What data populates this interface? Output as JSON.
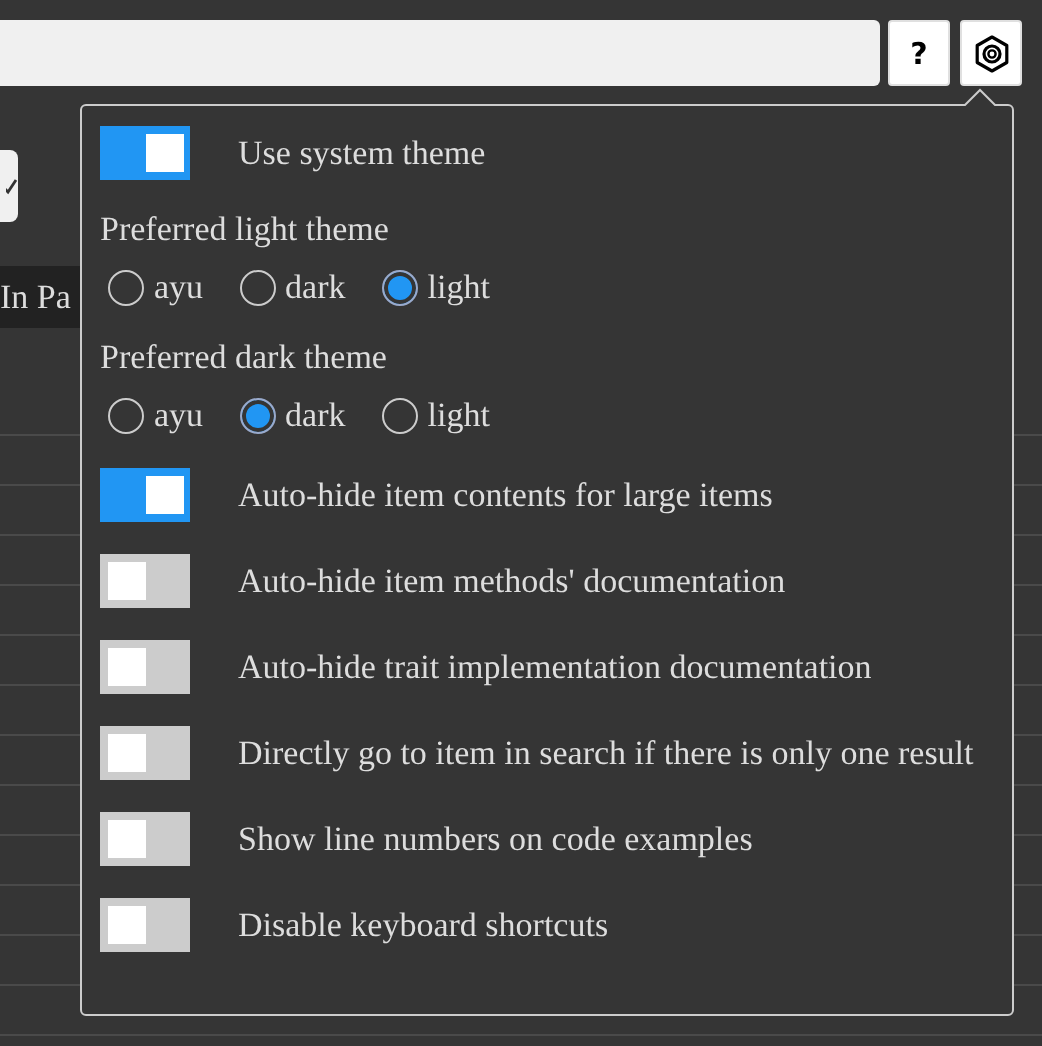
{
  "toolbar": {
    "help_button": "?"
  },
  "background": {
    "tab_label": "In Pa"
  },
  "settings": {
    "items": [
      {
        "kind": "toggle",
        "label": "Use system theme",
        "on": true
      },
      {
        "kind": "radio",
        "label": "Preferred light theme",
        "options": [
          {
            "label": "ayu",
            "selected": false
          },
          {
            "label": "dark",
            "selected": false
          },
          {
            "label": "light",
            "selected": true
          }
        ]
      },
      {
        "kind": "radio",
        "label": "Preferred dark theme",
        "options": [
          {
            "label": "ayu",
            "selected": false
          },
          {
            "label": "dark",
            "selected": true
          },
          {
            "label": "light",
            "selected": false
          }
        ]
      },
      {
        "kind": "toggle",
        "label": "Auto-hide item contents for large items",
        "on": true
      },
      {
        "kind": "toggle",
        "label": "Auto-hide item methods' documentation",
        "on": false
      },
      {
        "kind": "toggle",
        "label": "Auto-hide trait implementation documentation",
        "on": false
      },
      {
        "kind": "toggle",
        "label": "Directly go to item in search if there is only one result",
        "on": false
      },
      {
        "kind": "toggle",
        "label": "Show line numbers on code examples",
        "on": false
      },
      {
        "kind": "toggle",
        "label": "Disable keyboard shortcuts",
        "on": false
      }
    ]
  }
}
